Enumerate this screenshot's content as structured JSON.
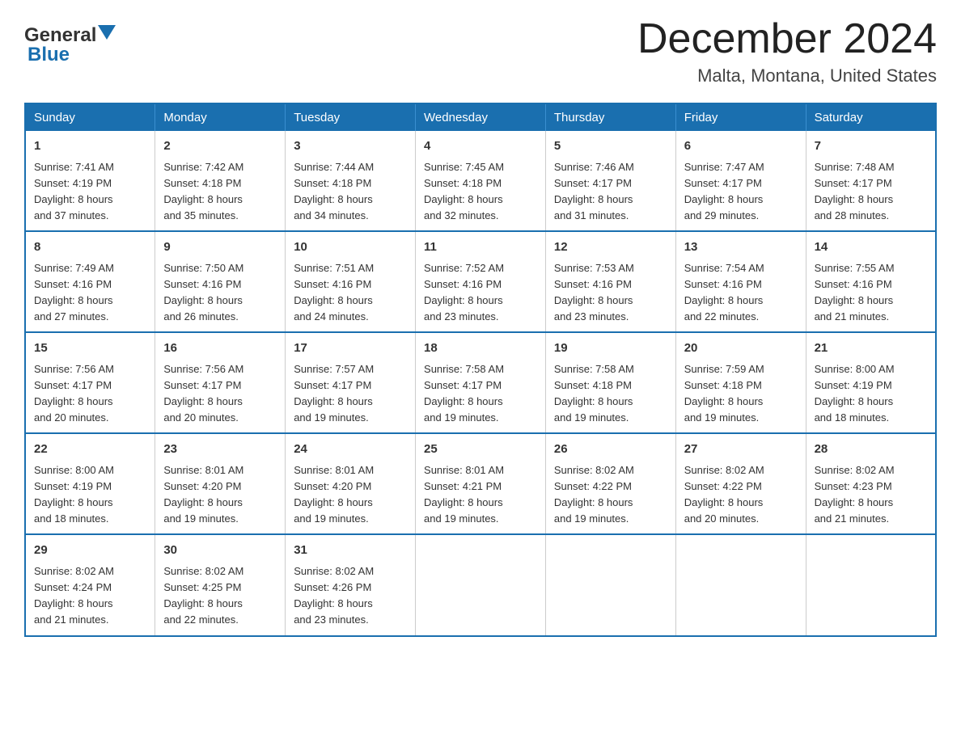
{
  "header": {
    "title": "December 2024",
    "subtitle": "Malta, Montana, United States",
    "logo_line1": "General",
    "logo_line2": "Blue"
  },
  "weekdays": [
    "Sunday",
    "Monday",
    "Tuesday",
    "Wednesday",
    "Thursday",
    "Friday",
    "Saturday"
  ],
  "weeks": [
    [
      {
        "day": "1",
        "sunrise": "7:41 AM",
        "sunset": "4:19 PM",
        "daylight": "8 hours and 37 minutes."
      },
      {
        "day": "2",
        "sunrise": "7:42 AM",
        "sunset": "4:18 PM",
        "daylight": "8 hours and 35 minutes."
      },
      {
        "day": "3",
        "sunrise": "7:44 AM",
        "sunset": "4:18 PM",
        "daylight": "8 hours and 34 minutes."
      },
      {
        "day": "4",
        "sunrise": "7:45 AM",
        "sunset": "4:18 PM",
        "daylight": "8 hours and 32 minutes."
      },
      {
        "day": "5",
        "sunrise": "7:46 AM",
        "sunset": "4:17 PM",
        "daylight": "8 hours and 31 minutes."
      },
      {
        "day": "6",
        "sunrise": "7:47 AM",
        "sunset": "4:17 PM",
        "daylight": "8 hours and 29 minutes."
      },
      {
        "day": "7",
        "sunrise": "7:48 AM",
        "sunset": "4:17 PM",
        "daylight": "8 hours and 28 minutes."
      }
    ],
    [
      {
        "day": "8",
        "sunrise": "7:49 AM",
        "sunset": "4:16 PM",
        "daylight": "8 hours and 27 minutes."
      },
      {
        "day": "9",
        "sunrise": "7:50 AM",
        "sunset": "4:16 PM",
        "daylight": "8 hours and 26 minutes."
      },
      {
        "day": "10",
        "sunrise": "7:51 AM",
        "sunset": "4:16 PM",
        "daylight": "8 hours and 24 minutes."
      },
      {
        "day": "11",
        "sunrise": "7:52 AM",
        "sunset": "4:16 PM",
        "daylight": "8 hours and 23 minutes."
      },
      {
        "day": "12",
        "sunrise": "7:53 AM",
        "sunset": "4:16 PM",
        "daylight": "8 hours and 23 minutes."
      },
      {
        "day": "13",
        "sunrise": "7:54 AM",
        "sunset": "4:16 PM",
        "daylight": "8 hours and 22 minutes."
      },
      {
        "day": "14",
        "sunrise": "7:55 AM",
        "sunset": "4:16 PM",
        "daylight": "8 hours and 21 minutes."
      }
    ],
    [
      {
        "day": "15",
        "sunrise": "7:56 AM",
        "sunset": "4:17 PM",
        "daylight": "8 hours and 20 minutes."
      },
      {
        "day": "16",
        "sunrise": "7:56 AM",
        "sunset": "4:17 PM",
        "daylight": "8 hours and 20 minutes."
      },
      {
        "day": "17",
        "sunrise": "7:57 AM",
        "sunset": "4:17 PM",
        "daylight": "8 hours and 19 minutes."
      },
      {
        "day": "18",
        "sunrise": "7:58 AM",
        "sunset": "4:17 PM",
        "daylight": "8 hours and 19 minutes."
      },
      {
        "day": "19",
        "sunrise": "7:58 AM",
        "sunset": "4:18 PM",
        "daylight": "8 hours and 19 minutes."
      },
      {
        "day": "20",
        "sunrise": "7:59 AM",
        "sunset": "4:18 PM",
        "daylight": "8 hours and 19 minutes."
      },
      {
        "day": "21",
        "sunrise": "8:00 AM",
        "sunset": "4:19 PM",
        "daylight": "8 hours and 18 minutes."
      }
    ],
    [
      {
        "day": "22",
        "sunrise": "8:00 AM",
        "sunset": "4:19 PM",
        "daylight": "8 hours and 18 minutes."
      },
      {
        "day": "23",
        "sunrise": "8:01 AM",
        "sunset": "4:20 PM",
        "daylight": "8 hours and 19 minutes."
      },
      {
        "day": "24",
        "sunrise": "8:01 AM",
        "sunset": "4:20 PM",
        "daylight": "8 hours and 19 minutes."
      },
      {
        "day": "25",
        "sunrise": "8:01 AM",
        "sunset": "4:21 PM",
        "daylight": "8 hours and 19 minutes."
      },
      {
        "day": "26",
        "sunrise": "8:02 AM",
        "sunset": "4:22 PM",
        "daylight": "8 hours and 19 minutes."
      },
      {
        "day": "27",
        "sunrise": "8:02 AM",
        "sunset": "4:22 PM",
        "daylight": "8 hours and 20 minutes."
      },
      {
        "day": "28",
        "sunrise": "8:02 AM",
        "sunset": "4:23 PM",
        "daylight": "8 hours and 21 minutes."
      }
    ],
    [
      {
        "day": "29",
        "sunrise": "8:02 AM",
        "sunset": "4:24 PM",
        "daylight": "8 hours and 21 minutes."
      },
      {
        "day": "30",
        "sunrise": "8:02 AM",
        "sunset": "4:25 PM",
        "daylight": "8 hours and 22 minutes."
      },
      {
        "day": "31",
        "sunrise": "8:02 AM",
        "sunset": "4:26 PM",
        "daylight": "8 hours and 23 minutes."
      },
      null,
      null,
      null,
      null
    ]
  ],
  "sunrise_label": "Sunrise: ",
  "sunset_label": "Sunset: ",
  "daylight_label": "Daylight: "
}
